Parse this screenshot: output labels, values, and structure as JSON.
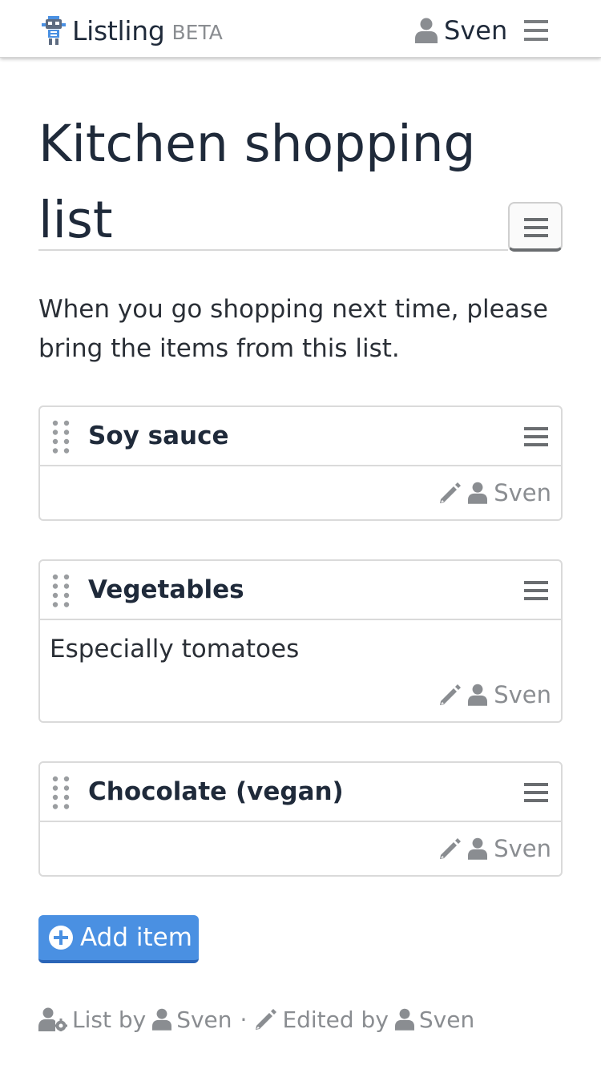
{
  "navbar": {
    "brand_name": "Listling",
    "brand_badge": "BETA",
    "user_name": "Sven",
    "menu_icon": "hamburger-menu-icon"
  },
  "list": {
    "title": "Kitchen shopping list",
    "description": "When you go shopping next time, please bring the items from this list.",
    "menu_icon": "hamburger-menu-icon"
  },
  "items": [
    {
      "title": "Soy sauce",
      "text": "",
      "editor": "Sven"
    },
    {
      "title": "Vegetables",
      "text": "Especially tomatoes",
      "editor": "Sven"
    },
    {
      "title": "Chocolate (vegan)",
      "text": "",
      "editor": "Sven"
    }
  ],
  "actions": {
    "add_item_label": "Add item"
  },
  "footer": {
    "list_by_label": "List by",
    "list_owner": "Sven",
    "separator": "·",
    "edited_by_label": "Edited by",
    "editor": "Sven"
  },
  "colors": {
    "primary": "#4a90e2",
    "text": "#1f2a3a",
    "muted": "#8a8d91",
    "border": "#dadada"
  }
}
